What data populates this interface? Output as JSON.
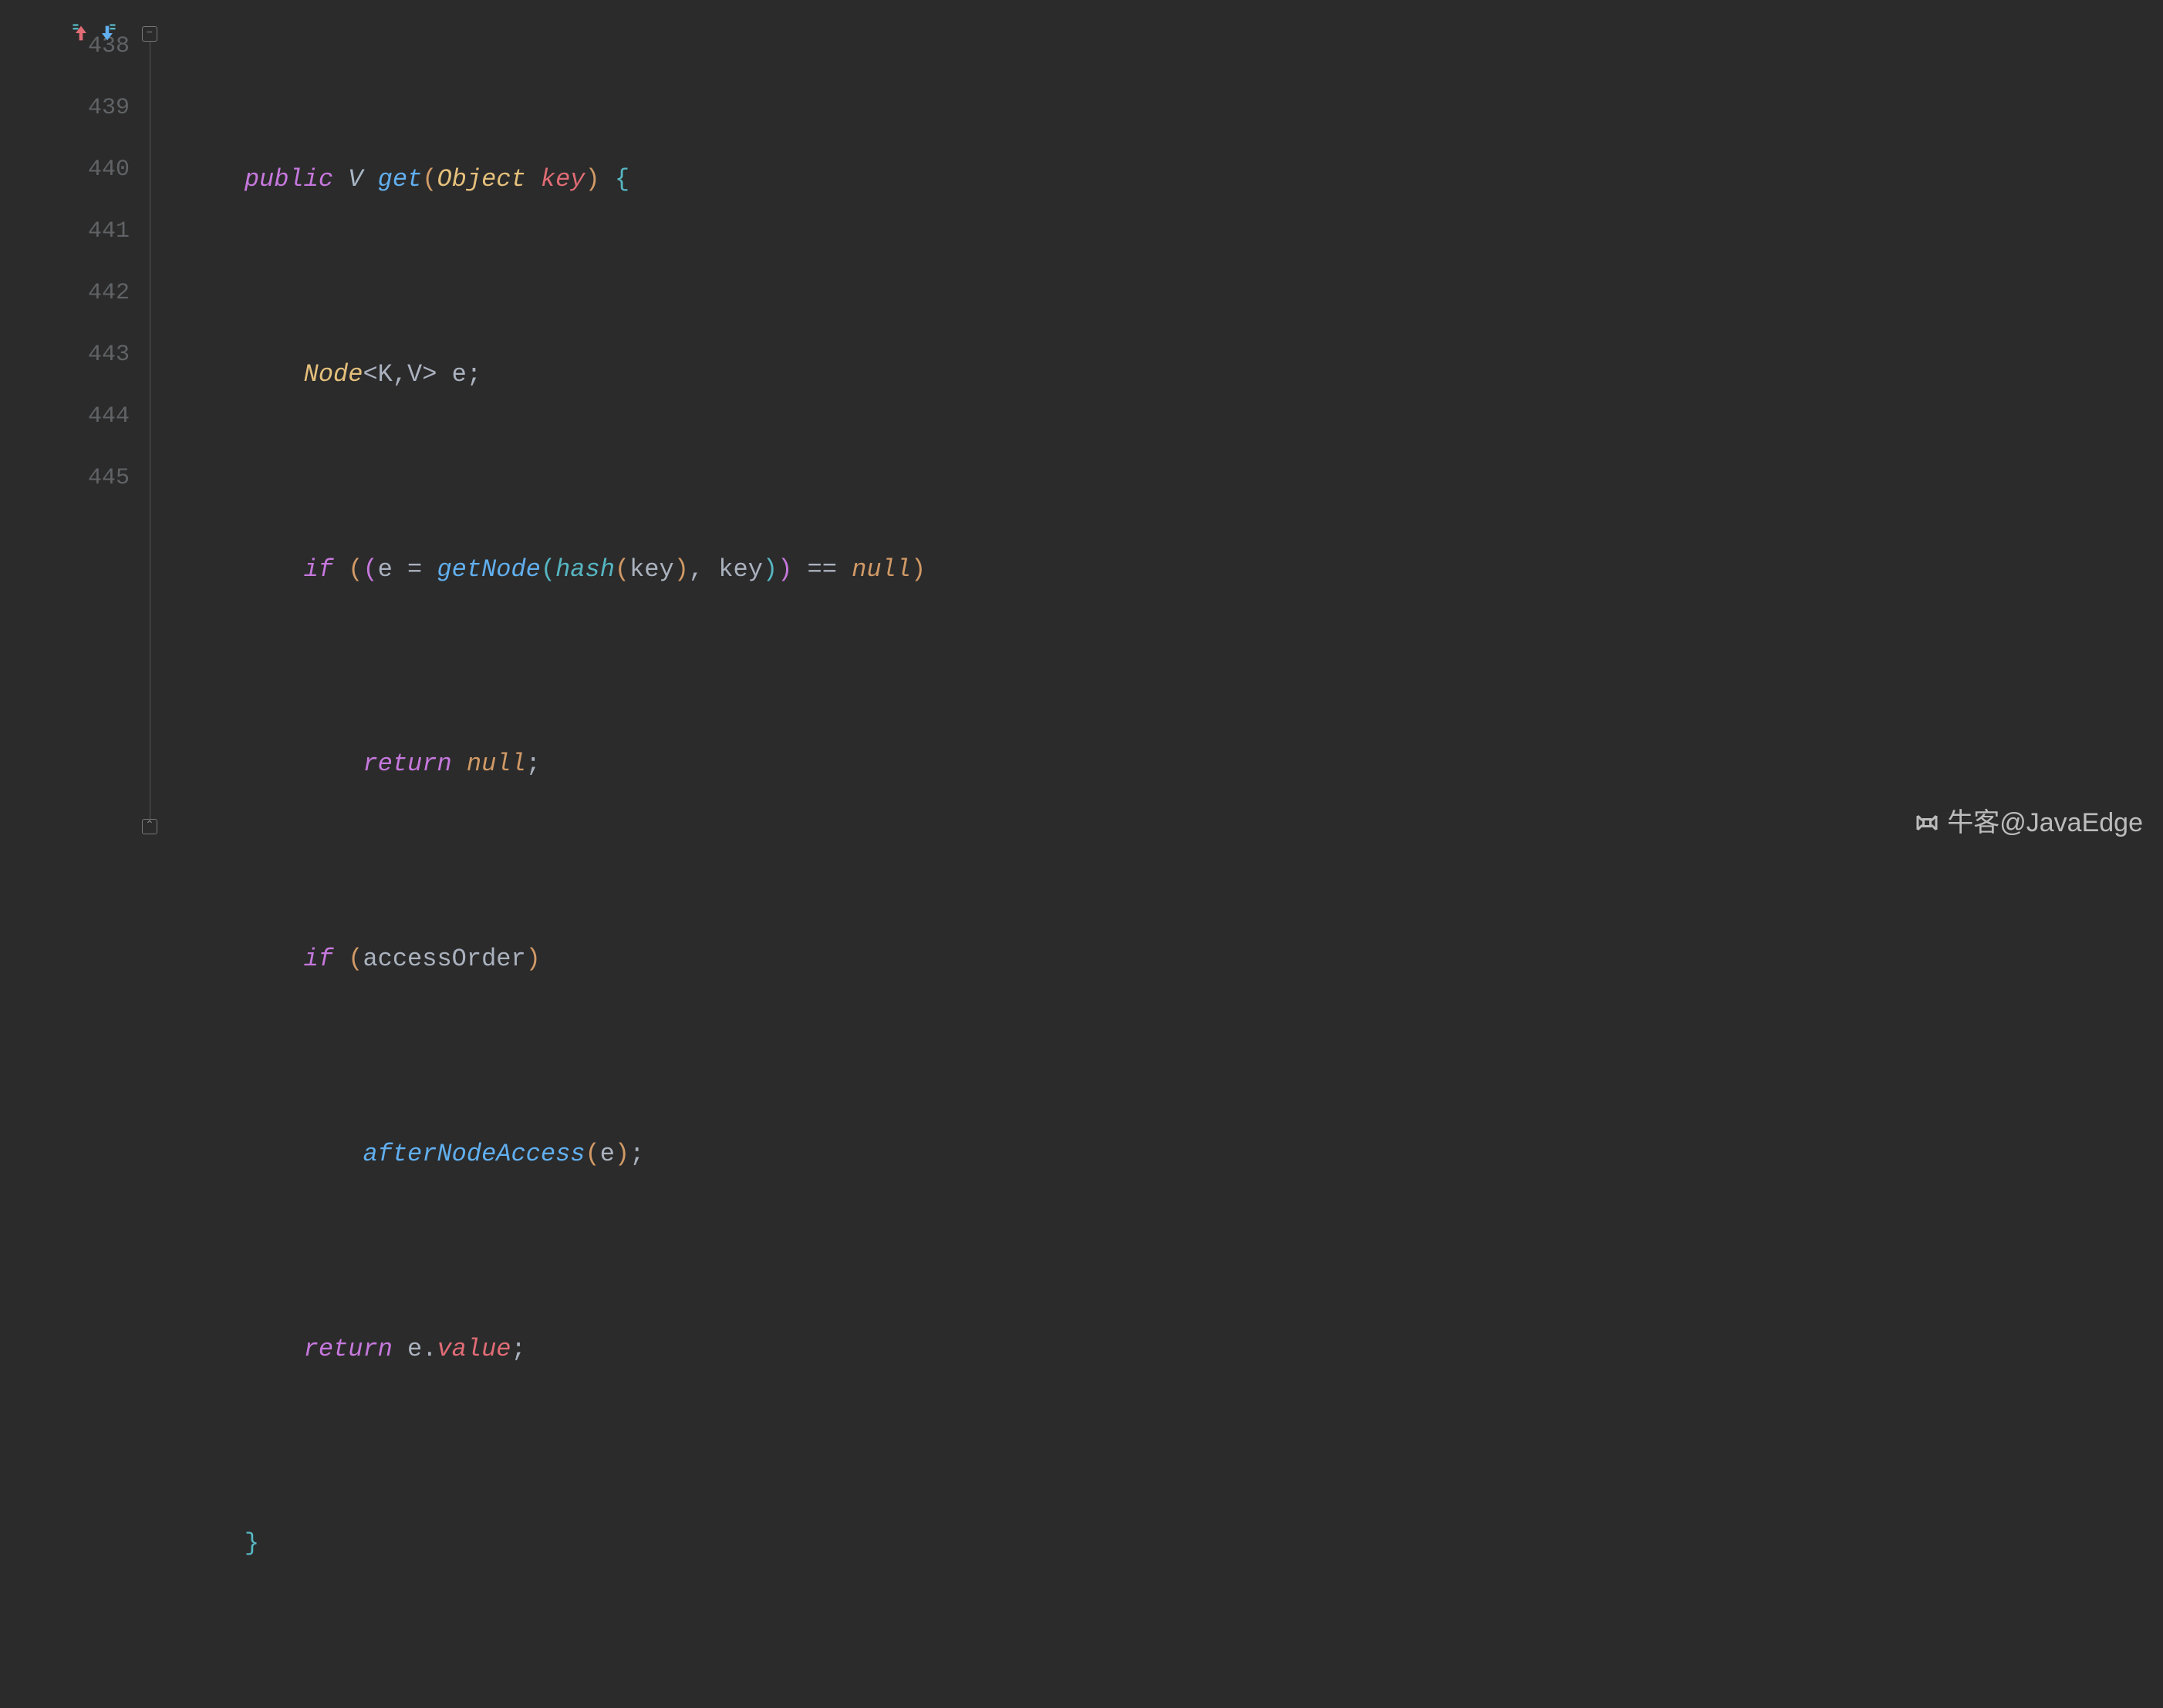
{
  "gutter": {
    "start": 438,
    "lines": [
      "438",
      "439",
      "440",
      "441",
      "442",
      "443",
      "444",
      "445"
    ]
  },
  "code": {
    "l438": {
      "public": "public",
      "V": "V",
      "get": "get",
      "Object": "Object",
      "key": "key"
    },
    "l439": {
      "Node": "Node",
      "K": "K",
      "V": "V",
      "e": "e"
    },
    "l440": {
      "if": "if",
      "e": "e",
      "getNode": "getNode",
      "hash": "hash",
      "key1": "key",
      "key2": "key",
      "eq": "==",
      "null": "null"
    },
    "l441": {
      "return": "return",
      "null": "null"
    },
    "l442": {
      "if": "if",
      "accessOrder": "accessOrder"
    },
    "l443": {
      "afterNodeAccess": "afterNodeAccess",
      "e": "e"
    },
    "l444": {
      "return": "return",
      "e": "e",
      "value": "value"
    }
  },
  "watermark": {
    "text": "牛客@JavaEdge"
  }
}
